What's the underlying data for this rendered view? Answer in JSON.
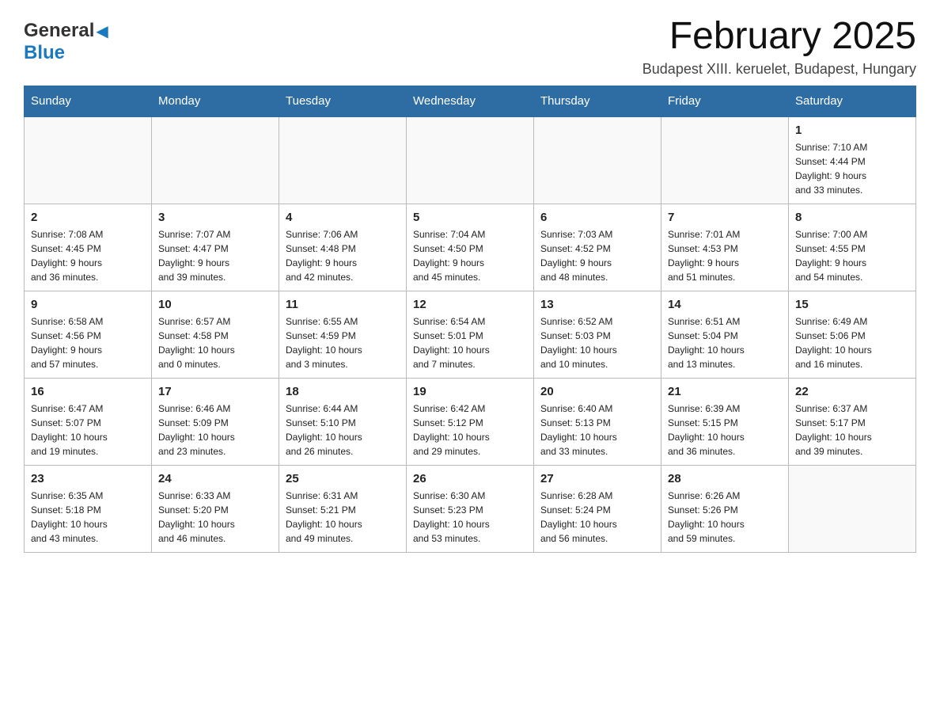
{
  "header": {
    "logo_general": "General",
    "logo_blue": "Blue",
    "month_title": "February 2025",
    "location": "Budapest XIII. keruelet, Budapest, Hungary"
  },
  "weekdays": [
    "Sunday",
    "Monday",
    "Tuesday",
    "Wednesday",
    "Thursday",
    "Friday",
    "Saturday"
  ],
  "weeks": [
    [
      {
        "day": "",
        "info": ""
      },
      {
        "day": "",
        "info": ""
      },
      {
        "day": "",
        "info": ""
      },
      {
        "day": "",
        "info": ""
      },
      {
        "day": "",
        "info": ""
      },
      {
        "day": "",
        "info": ""
      },
      {
        "day": "1",
        "info": "Sunrise: 7:10 AM\nSunset: 4:44 PM\nDaylight: 9 hours\nand 33 minutes."
      }
    ],
    [
      {
        "day": "2",
        "info": "Sunrise: 7:08 AM\nSunset: 4:45 PM\nDaylight: 9 hours\nand 36 minutes."
      },
      {
        "day": "3",
        "info": "Sunrise: 7:07 AM\nSunset: 4:47 PM\nDaylight: 9 hours\nand 39 minutes."
      },
      {
        "day": "4",
        "info": "Sunrise: 7:06 AM\nSunset: 4:48 PM\nDaylight: 9 hours\nand 42 minutes."
      },
      {
        "day": "5",
        "info": "Sunrise: 7:04 AM\nSunset: 4:50 PM\nDaylight: 9 hours\nand 45 minutes."
      },
      {
        "day": "6",
        "info": "Sunrise: 7:03 AM\nSunset: 4:52 PM\nDaylight: 9 hours\nand 48 minutes."
      },
      {
        "day": "7",
        "info": "Sunrise: 7:01 AM\nSunset: 4:53 PM\nDaylight: 9 hours\nand 51 minutes."
      },
      {
        "day": "8",
        "info": "Sunrise: 7:00 AM\nSunset: 4:55 PM\nDaylight: 9 hours\nand 54 minutes."
      }
    ],
    [
      {
        "day": "9",
        "info": "Sunrise: 6:58 AM\nSunset: 4:56 PM\nDaylight: 9 hours\nand 57 minutes."
      },
      {
        "day": "10",
        "info": "Sunrise: 6:57 AM\nSunset: 4:58 PM\nDaylight: 10 hours\nand 0 minutes."
      },
      {
        "day": "11",
        "info": "Sunrise: 6:55 AM\nSunset: 4:59 PM\nDaylight: 10 hours\nand 3 minutes."
      },
      {
        "day": "12",
        "info": "Sunrise: 6:54 AM\nSunset: 5:01 PM\nDaylight: 10 hours\nand 7 minutes."
      },
      {
        "day": "13",
        "info": "Sunrise: 6:52 AM\nSunset: 5:03 PM\nDaylight: 10 hours\nand 10 minutes."
      },
      {
        "day": "14",
        "info": "Sunrise: 6:51 AM\nSunset: 5:04 PM\nDaylight: 10 hours\nand 13 minutes."
      },
      {
        "day": "15",
        "info": "Sunrise: 6:49 AM\nSunset: 5:06 PM\nDaylight: 10 hours\nand 16 minutes."
      }
    ],
    [
      {
        "day": "16",
        "info": "Sunrise: 6:47 AM\nSunset: 5:07 PM\nDaylight: 10 hours\nand 19 minutes."
      },
      {
        "day": "17",
        "info": "Sunrise: 6:46 AM\nSunset: 5:09 PM\nDaylight: 10 hours\nand 23 minutes."
      },
      {
        "day": "18",
        "info": "Sunrise: 6:44 AM\nSunset: 5:10 PM\nDaylight: 10 hours\nand 26 minutes."
      },
      {
        "day": "19",
        "info": "Sunrise: 6:42 AM\nSunset: 5:12 PM\nDaylight: 10 hours\nand 29 minutes."
      },
      {
        "day": "20",
        "info": "Sunrise: 6:40 AM\nSunset: 5:13 PM\nDaylight: 10 hours\nand 33 minutes."
      },
      {
        "day": "21",
        "info": "Sunrise: 6:39 AM\nSunset: 5:15 PM\nDaylight: 10 hours\nand 36 minutes."
      },
      {
        "day": "22",
        "info": "Sunrise: 6:37 AM\nSunset: 5:17 PM\nDaylight: 10 hours\nand 39 minutes."
      }
    ],
    [
      {
        "day": "23",
        "info": "Sunrise: 6:35 AM\nSunset: 5:18 PM\nDaylight: 10 hours\nand 43 minutes."
      },
      {
        "day": "24",
        "info": "Sunrise: 6:33 AM\nSunset: 5:20 PM\nDaylight: 10 hours\nand 46 minutes."
      },
      {
        "day": "25",
        "info": "Sunrise: 6:31 AM\nSunset: 5:21 PM\nDaylight: 10 hours\nand 49 minutes."
      },
      {
        "day": "26",
        "info": "Sunrise: 6:30 AM\nSunset: 5:23 PM\nDaylight: 10 hours\nand 53 minutes."
      },
      {
        "day": "27",
        "info": "Sunrise: 6:28 AM\nSunset: 5:24 PM\nDaylight: 10 hours\nand 56 minutes."
      },
      {
        "day": "28",
        "info": "Sunrise: 6:26 AM\nSunset: 5:26 PM\nDaylight: 10 hours\nand 59 minutes."
      },
      {
        "day": "",
        "info": ""
      }
    ]
  ]
}
